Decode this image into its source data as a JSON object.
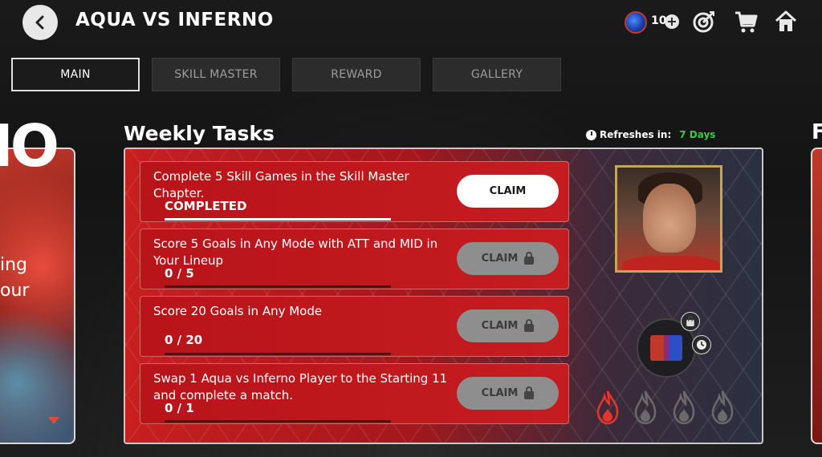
{
  "header": {
    "title": "AQUA VS INFERNO",
    "currency_count": "10",
    "plus_label": "+"
  },
  "tabs": [
    {
      "label": "MAIN",
      "active": true
    },
    {
      "label": "SKILL MASTER",
      "active": false
    },
    {
      "label": "REWARD",
      "active": false
    },
    {
      "label": "GALLERY",
      "active": false
    }
  ],
  "left_card": {
    "big_text": "IO",
    "line1": "ing",
    "line2": "our"
  },
  "right_card": {
    "big_text": "F"
  },
  "weekly": {
    "title": "Weekly Tasks",
    "refresh_label": "Refreshes in:",
    "refresh_value": "7 Days"
  },
  "tasks": [
    {
      "desc": "Complete 5 Skill Games in the Skill Master Chapter.",
      "progress": "COMPLETED",
      "fraction": 1.0,
      "claim": "CLAIM",
      "claimable": true
    },
    {
      "desc": "Score 5 Goals in Any Mode with ATT and MID in Your Lineup",
      "progress": "0 / 5",
      "fraction": 0.0,
      "claim": "CLAIM",
      "claimable": false
    },
    {
      "desc": "Score 20 Goals in Any Mode",
      "progress": "0 / 20",
      "fraction": 0.0,
      "claim": "CLAIM",
      "claimable": false
    },
    {
      "desc": "Swap 1 Aqua vs Inferno Player to the Starting 11 and complete a match.",
      "progress": "0 / 1",
      "fraction": 0.0,
      "claim": "CLAIM",
      "claimable": false
    }
  ],
  "flames": [
    {
      "active": true,
      "color": "#e8342a"
    },
    {
      "active": false,
      "color": "#6a6a6a"
    },
    {
      "active": false,
      "color": "#6a6a6a"
    },
    {
      "active": false,
      "color": "#6a6a6a"
    }
  ],
  "icons": {
    "back": "chevron-left-icon",
    "target": "target-icon",
    "cart": "cart-icon",
    "home": "home-icon",
    "timer": "timer-icon",
    "lock": "lock-icon",
    "clock": "clock-icon",
    "gift": "gift-icon",
    "flame": "flame-icon"
  }
}
